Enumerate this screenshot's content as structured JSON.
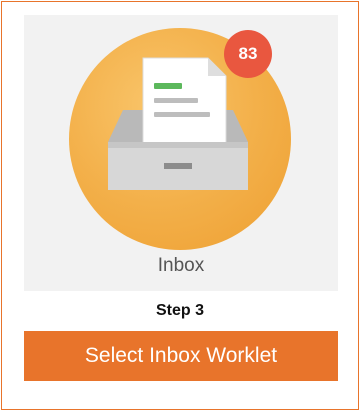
{
  "tile": {
    "label": "Inbox",
    "badge_count": "83",
    "icon": "inbox-tray-with-document-icon"
  },
  "step_label": "Step 3",
  "cta_label": "Select Inbox Worklet",
  "colors": {
    "accent_orange": "#e8742b",
    "badge_red": "#e9573f",
    "circle_orange": "#f3b04a",
    "tile_background": "#f2f2f2",
    "document_green": "#5cb85c"
  }
}
